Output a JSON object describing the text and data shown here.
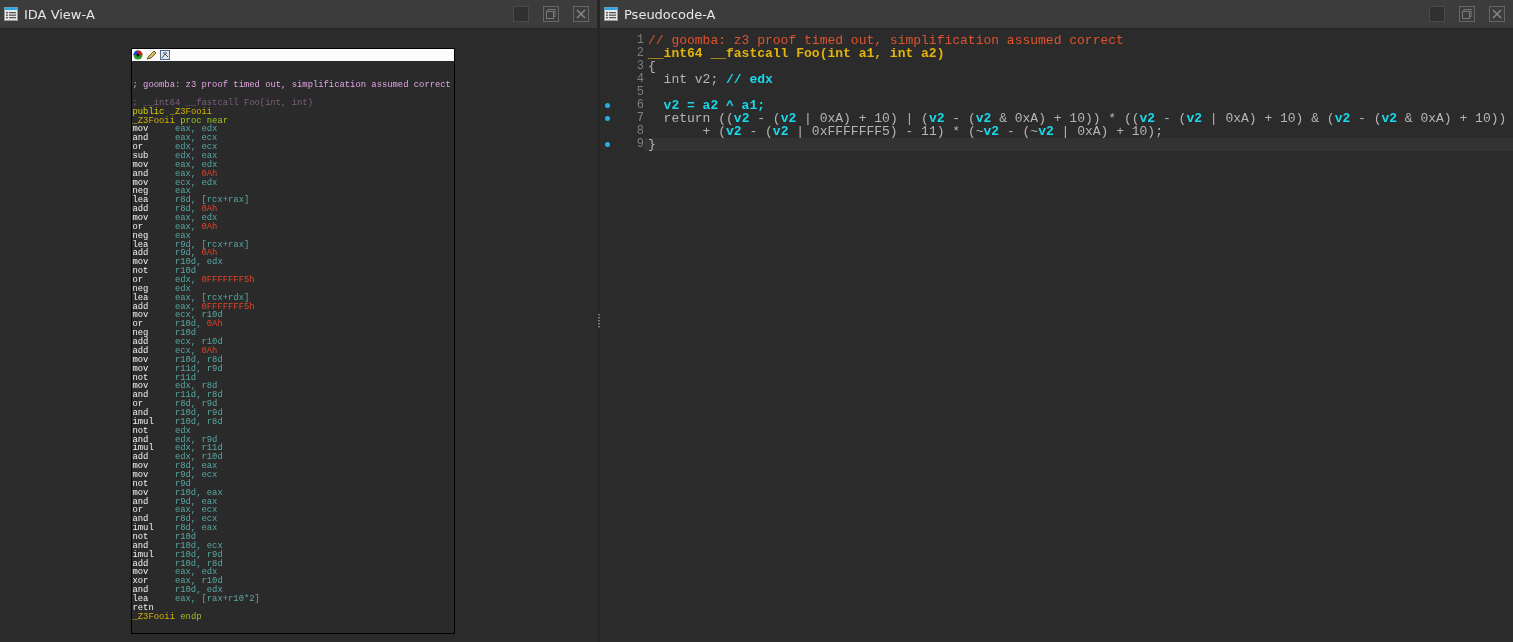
{
  "ida_view": {
    "title": "IDA View-A",
    "listing": [
      {
        "tokens": [
          {
            "text": "; goomba: z3 proof timed out, simplification assumed correct",
            "kind": "comment"
          }
        ]
      },
      {
        "tokens": [
          {
            "text": "; __int64 __fastcall Foo(int, int)",
            "kind": "header"
          }
        ]
      },
      {
        "tokens": [
          {
            "text": "public ",
            "kind": "keyword"
          },
          {
            "text": "_Z3Fooii",
            "kind": "name"
          }
        ]
      },
      {
        "tokens": [
          {
            "text": "_Z3Fooii ",
            "kind": "name"
          },
          {
            "text": "proc near",
            "kind": "directive"
          }
        ]
      },
      {
        "tokens": [
          {
            "text": "mov",
            "kind": "mnemonic"
          },
          {
            "text": "eax, edx",
            "kind": "reg"
          }
        ]
      },
      {
        "tokens": [
          {
            "text": "and",
            "kind": "mnemonic"
          },
          {
            "text": "eax, ecx",
            "kind": "reg"
          }
        ]
      },
      {
        "tokens": [
          {
            "text": "or",
            "kind": "mnemonic"
          },
          {
            "text": "edx, ecx",
            "kind": "reg"
          }
        ]
      },
      {
        "tokens": [
          {
            "text": "sub",
            "kind": "mnemonic"
          },
          {
            "text": "edx, eax",
            "kind": "reg"
          }
        ]
      },
      {
        "tokens": [
          {
            "text": "mov",
            "kind": "mnemonic"
          },
          {
            "text": "eax, edx",
            "kind": "reg"
          }
        ]
      },
      {
        "tokens": [
          {
            "text": "and",
            "kind": "mnemonic"
          },
          {
            "text": "eax, ",
            "kind": "reg"
          },
          {
            "text": "0Ah",
            "kind": "imm"
          }
        ]
      },
      {
        "tokens": [
          {
            "text": "mov",
            "kind": "mnemonic"
          },
          {
            "text": "ecx, edx",
            "kind": "reg"
          }
        ]
      },
      {
        "tokens": [
          {
            "text": "neg",
            "kind": "mnemonic"
          },
          {
            "text": "eax",
            "kind": "reg"
          }
        ]
      },
      {
        "tokens": [
          {
            "text": "lea",
            "kind": "mnemonic"
          },
          {
            "text": "r8d, [rcx+rax]",
            "kind": "reg"
          }
        ]
      },
      {
        "tokens": [
          {
            "text": "add",
            "kind": "mnemonic"
          },
          {
            "text": "r8d, ",
            "kind": "reg"
          },
          {
            "text": "0Ah",
            "kind": "imm"
          }
        ]
      },
      {
        "tokens": [
          {
            "text": "mov",
            "kind": "mnemonic"
          },
          {
            "text": "eax, edx",
            "kind": "reg"
          }
        ]
      },
      {
        "tokens": [
          {
            "text": "or",
            "kind": "mnemonic"
          },
          {
            "text": "eax, ",
            "kind": "reg"
          },
          {
            "text": "0Ah",
            "kind": "imm"
          }
        ]
      },
      {
        "tokens": [
          {
            "text": "neg",
            "kind": "mnemonic"
          },
          {
            "text": "eax",
            "kind": "reg"
          }
        ]
      },
      {
        "tokens": [
          {
            "text": "lea",
            "kind": "mnemonic"
          },
          {
            "text": "r9d, [rcx+rax]",
            "kind": "reg"
          }
        ]
      },
      {
        "tokens": [
          {
            "text": "add",
            "kind": "mnemonic"
          },
          {
            "text": "r9d, ",
            "kind": "reg"
          },
          {
            "text": "0Ah",
            "kind": "imm"
          }
        ]
      },
      {
        "tokens": [
          {
            "text": "mov",
            "kind": "mnemonic"
          },
          {
            "text": "r10d, edx",
            "kind": "reg"
          }
        ]
      },
      {
        "tokens": [
          {
            "text": "not",
            "kind": "mnemonic"
          },
          {
            "text": "r10d",
            "kind": "reg"
          }
        ]
      },
      {
        "tokens": [
          {
            "text": "or",
            "kind": "mnemonic"
          },
          {
            "text": "edx, ",
            "kind": "reg"
          },
          {
            "text": "0FFFFFFF5h",
            "kind": "imm"
          }
        ]
      },
      {
        "tokens": [
          {
            "text": "neg",
            "kind": "mnemonic"
          },
          {
            "text": "edx",
            "kind": "reg"
          }
        ]
      },
      {
        "tokens": [
          {
            "text": "lea",
            "kind": "mnemonic"
          },
          {
            "text": "eax, [rcx+rdx]",
            "kind": "reg"
          }
        ]
      },
      {
        "tokens": [
          {
            "text": "add",
            "kind": "mnemonic"
          },
          {
            "text": "eax, ",
            "kind": "reg"
          },
          {
            "text": "0FFFFFFF5h",
            "kind": "imm"
          }
        ]
      },
      {
        "tokens": [
          {
            "text": "mov",
            "kind": "mnemonic"
          },
          {
            "text": "ecx, r10d",
            "kind": "reg"
          }
        ]
      },
      {
        "tokens": [
          {
            "text": "or",
            "kind": "mnemonic"
          },
          {
            "text": "r10d, ",
            "kind": "reg"
          },
          {
            "text": "0Ah",
            "kind": "imm"
          }
        ]
      },
      {
        "tokens": [
          {
            "text": "neg",
            "kind": "mnemonic"
          },
          {
            "text": "r10d",
            "kind": "reg"
          }
        ]
      },
      {
        "tokens": [
          {
            "text": "add",
            "kind": "mnemonic"
          },
          {
            "text": "ecx, r10d",
            "kind": "reg"
          }
        ]
      },
      {
        "tokens": [
          {
            "text": "add",
            "kind": "mnemonic"
          },
          {
            "text": "ecx, ",
            "kind": "reg"
          },
          {
            "text": "0Ah",
            "kind": "imm"
          }
        ]
      },
      {
        "tokens": [
          {
            "text": "mov",
            "kind": "mnemonic"
          },
          {
            "text": "r10d, r8d",
            "kind": "reg"
          }
        ]
      },
      {
        "tokens": [
          {
            "text": "mov",
            "kind": "mnemonic"
          },
          {
            "text": "r11d, r9d",
            "kind": "reg"
          }
        ]
      },
      {
        "tokens": [
          {
            "text": "not",
            "kind": "mnemonic"
          },
          {
            "text": "r11d",
            "kind": "reg"
          }
        ]
      },
      {
        "tokens": [
          {
            "text": "mov",
            "kind": "mnemonic"
          },
          {
            "text": "edx, r8d",
            "kind": "reg"
          }
        ]
      },
      {
        "tokens": [
          {
            "text": "and",
            "kind": "mnemonic"
          },
          {
            "text": "r11d, r8d",
            "kind": "reg"
          }
        ]
      },
      {
        "tokens": [
          {
            "text": "or",
            "kind": "mnemonic"
          },
          {
            "text": "r8d, r9d",
            "kind": "reg"
          }
        ]
      },
      {
        "tokens": [
          {
            "text": "and",
            "kind": "mnemonic"
          },
          {
            "text": "r10d, r9d",
            "kind": "reg"
          }
        ]
      },
      {
        "tokens": [
          {
            "text": "imul",
            "kind": "mnemonic"
          },
          {
            "text": "r10d, r8d",
            "kind": "reg"
          }
        ]
      },
      {
        "tokens": [
          {
            "text": "not",
            "kind": "mnemonic"
          },
          {
            "text": "edx",
            "kind": "reg"
          }
        ]
      },
      {
        "tokens": [
          {
            "text": "and",
            "kind": "mnemonic"
          },
          {
            "text": "edx, r9d",
            "kind": "reg"
          }
        ]
      },
      {
        "tokens": [
          {
            "text": "imul",
            "kind": "mnemonic"
          },
          {
            "text": "edx, r11d",
            "kind": "reg"
          }
        ]
      },
      {
        "tokens": [
          {
            "text": "add",
            "kind": "mnemonic"
          },
          {
            "text": "edx, r10d",
            "kind": "reg"
          }
        ]
      },
      {
        "tokens": [
          {
            "text": "mov",
            "kind": "mnemonic"
          },
          {
            "text": "r8d, eax",
            "kind": "reg"
          }
        ]
      },
      {
        "tokens": [
          {
            "text": "mov",
            "kind": "mnemonic"
          },
          {
            "text": "r9d, ecx",
            "kind": "reg"
          }
        ]
      },
      {
        "tokens": [
          {
            "text": "not",
            "kind": "mnemonic"
          },
          {
            "text": "r9d",
            "kind": "reg"
          }
        ]
      },
      {
        "tokens": [
          {
            "text": "mov",
            "kind": "mnemonic"
          },
          {
            "text": "r10d, eax",
            "kind": "reg"
          }
        ]
      },
      {
        "tokens": [
          {
            "text": "and",
            "kind": "mnemonic"
          },
          {
            "text": "r9d, eax",
            "kind": "reg"
          }
        ]
      },
      {
        "tokens": [
          {
            "text": "or",
            "kind": "mnemonic"
          },
          {
            "text": "eax, ecx",
            "kind": "reg"
          }
        ]
      },
      {
        "tokens": [
          {
            "text": "and",
            "kind": "mnemonic"
          },
          {
            "text": "r8d, ecx",
            "kind": "reg"
          }
        ]
      },
      {
        "tokens": [
          {
            "text": "imul",
            "kind": "mnemonic"
          },
          {
            "text": "r8d, eax",
            "kind": "reg"
          }
        ]
      },
      {
        "tokens": [
          {
            "text": "not",
            "kind": "mnemonic"
          },
          {
            "text": "r10d",
            "kind": "reg"
          }
        ]
      },
      {
        "tokens": [
          {
            "text": "and",
            "kind": "mnemonic"
          },
          {
            "text": "r10d, ecx",
            "kind": "reg"
          }
        ]
      },
      {
        "tokens": [
          {
            "text": "imul",
            "kind": "mnemonic"
          },
          {
            "text": "r10d, r9d",
            "kind": "reg"
          }
        ]
      },
      {
        "tokens": [
          {
            "text": "add",
            "kind": "mnemonic"
          },
          {
            "text": "r10d, r8d",
            "kind": "reg"
          }
        ]
      },
      {
        "tokens": [
          {
            "text": "mov",
            "kind": "mnemonic"
          },
          {
            "text": "eax, edx",
            "kind": "reg"
          }
        ]
      },
      {
        "tokens": [
          {
            "text": "xor",
            "kind": "mnemonic"
          },
          {
            "text": "eax, r10d",
            "kind": "reg"
          }
        ]
      },
      {
        "tokens": [
          {
            "text": "and",
            "kind": "mnemonic"
          },
          {
            "text": "r10d, edx",
            "kind": "reg"
          }
        ]
      },
      {
        "tokens": [
          {
            "text": "lea",
            "kind": "mnemonic"
          },
          {
            "text": "eax, [rax+r10*2]",
            "kind": "reg"
          }
        ]
      },
      {
        "tokens": [
          {
            "text": "retn",
            "kind": "mnemonic"
          }
        ]
      },
      {
        "tokens": [
          {
            "text": "_Z3Fooii ",
            "kind": "name"
          },
          {
            "text": "endp",
            "kind": "directive"
          }
        ]
      }
    ]
  },
  "pseudocode": {
    "title": "Pseudocode-A",
    "lines": [
      {
        "number": "1",
        "marked": false,
        "current": false,
        "tokens": [
          {
            "text": "// goomba: z3 proof timed out, simplification assumed correct",
            "kind": "comment"
          }
        ]
      },
      {
        "number": "2",
        "marked": false,
        "current": false,
        "tokens": [
          {
            "text": "__int64 __fastcall Foo(int a1, int a2)",
            "kind": "decl"
          }
        ]
      },
      {
        "number": "3",
        "marked": false,
        "current": false,
        "tokens": [
          {
            "text": "{",
            "kind": "plain"
          }
        ]
      },
      {
        "number": "4",
        "marked": false,
        "current": false,
        "tokens": [
          {
            "text": "  int v2; ",
            "kind": "plain"
          },
          {
            "text": "// edx",
            "kind": "note"
          }
        ]
      },
      {
        "number": "5",
        "marked": false,
        "current": false
      },
      {
        "number": "6",
        "marked": true,
        "current": false,
        "tokens": [
          {
            "text": "  v2 = a2 ^ a1;",
            "kind": "var"
          }
        ]
      },
      {
        "number": "7",
        "marked": true,
        "current": false,
        "tokens": [
          {
            "text": "  return ((",
            "kind": "plain"
          },
          {
            "text": "v2",
            "kind": "var"
          },
          {
            "text": " - (",
            "kind": "plain"
          },
          {
            "text": "v2",
            "kind": "var"
          },
          {
            "text": " | 0xA) + 10) | (",
            "kind": "plain"
          },
          {
            "text": "v2",
            "kind": "var"
          },
          {
            "text": " - (",
            "kind": "plain"
          },
          {
            "text": "v2",
            "kind": "var"
          },
          {
            "text": " & 0xA) + 10)) * ((",
            "kind": "plain"
          },
          {
            "text": "v2",
            "kind": "var"
          },
          {
            "text": " - (",
            "kind": "plain"
          },
          {
            "text": "v2",
            "kind": "var"
          },
          {
            "text": " | 0xA) + 10) & (",
            "kind": "plain"
          },
          {
            "text": "v2",
            "kind": "var"
          },
          {
            "text": " - (",
            "kind": "plain"
          },
          {
            "text": "v2",
            "kind": "var"
          },
          {
            "text": " & 0xA) + 10))",
            "kind": "plain"
          }
        ]
      },
      {
        "number": "8",
        "marked": false,
        "current": false,
        "tokens": [
          {
            "text": "       + (",
            "kind": "plain"
          },
          {
            "text": "v2",
            "kind": "var"
          },
          {
            "text": " - (",
            "kind": "plain"
          },
          {
            "text": "v2",
            "kind": "var"
          },
          {
            "text": " | 0xFFFFFFF5) - 11) * (~",
            "kind": "plain"
          },
          {
            "text": "v2",
            "kind": "var"
          },
          {
            "text": " - (~",
            "kind": "plain"
          },
          {
            "text": "v2",
            "kind": "var"
          },
          {
            "text": " | 0xA) + 10);",
            "kind": "plain"
          }
        ]
      },
      {
        "number": "9",
        "marked": true,
        "current": true,
        "tokens": [
          {
            "text": "}",
            "kind": "plain"
          }
        ]
      }
    ]
  }
}
